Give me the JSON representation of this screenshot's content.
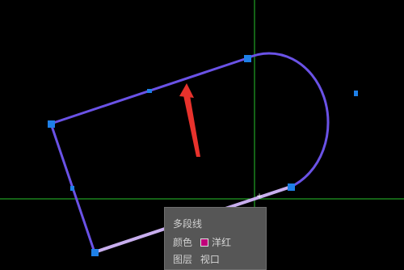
{
  "viewport": {
    "background": "#000000",
    "crosshair_color": "#29c32b",
    "polyline_color": "#6a52e6",
    "selected_segment_color": "#c8aeee",
    "grip_color": "#1e80e8",
    "arrow_color": "#e8322c",
    "cursor_glyph": "+"
  },
  "tooltip": {
    "title": "多段线",
    "rows": [
      {
        "label": "颜色",
        "value": "洋红",
        "swatch": "#c0007a"
      },
      {
        "label": "图层",
        "value": "视口"
      }
    ]
  }
}
